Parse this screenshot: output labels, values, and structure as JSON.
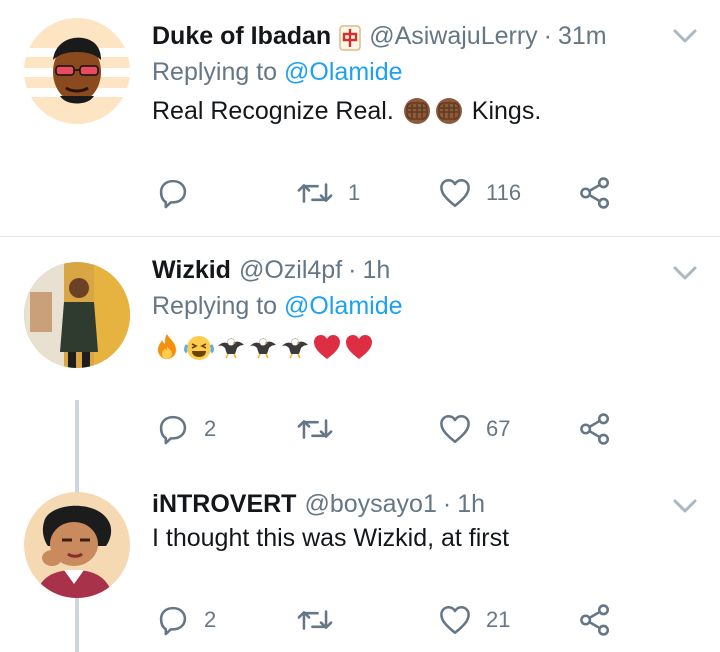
{
  "tweets": [
    {
      "name": "Duke of Ibadan",
      "badge_icon": "mahjong-red-dragon-icon",
      "handle": "@AsiwajuLerry",
      "separator": "·",
      "time": "31m",
      "reply_prefix": "Replying to",
      "reply_to": "@Olamide",
      "text_part1": "Real Recognize Real.",
      "text_emojis": [
        "fist-medium-dark-icon",
        "fist-medium-dark-icon"
      ],
      "text_part2": "Kings.",
      "replies": "",
      "retweets": "1",
      "likes": "116"
    },
    {
      "name": "Wizkid",
      "handle": "@Ozil4pf",
      "separator": "·",
      "time": "1h",
      "reply_prefix": "Replying to",
      "reply_to": "@Olamide",
      "emojis": [
        "fire-icon",
        "laughing-tears-icon",
        "eagle-icon",
        "eagle-icon",
        "eagle-icon",
        "red-heart-icon",
        "red-heart-icon"
      ],
      "replies": "2",
      "retweets": "",
      "likes": "67"
    },
    {
      "name": "iNTROVERT",
      "handle": "@boysayo1",
      "separator": "·",
      "time": "1h",
      "text": "I thought this was Wizkid, at first",
      "replies": "2",
      "retweets": "",
      "likes": "21"
    }
  ],
  "colors": {
    "text": "#14171a",
    "secondary": "#657786",
    "link": "#1da1f2",
    "divider": "#e1e8ed",
    "thread_line": "#ccd6dd"
  }
}
